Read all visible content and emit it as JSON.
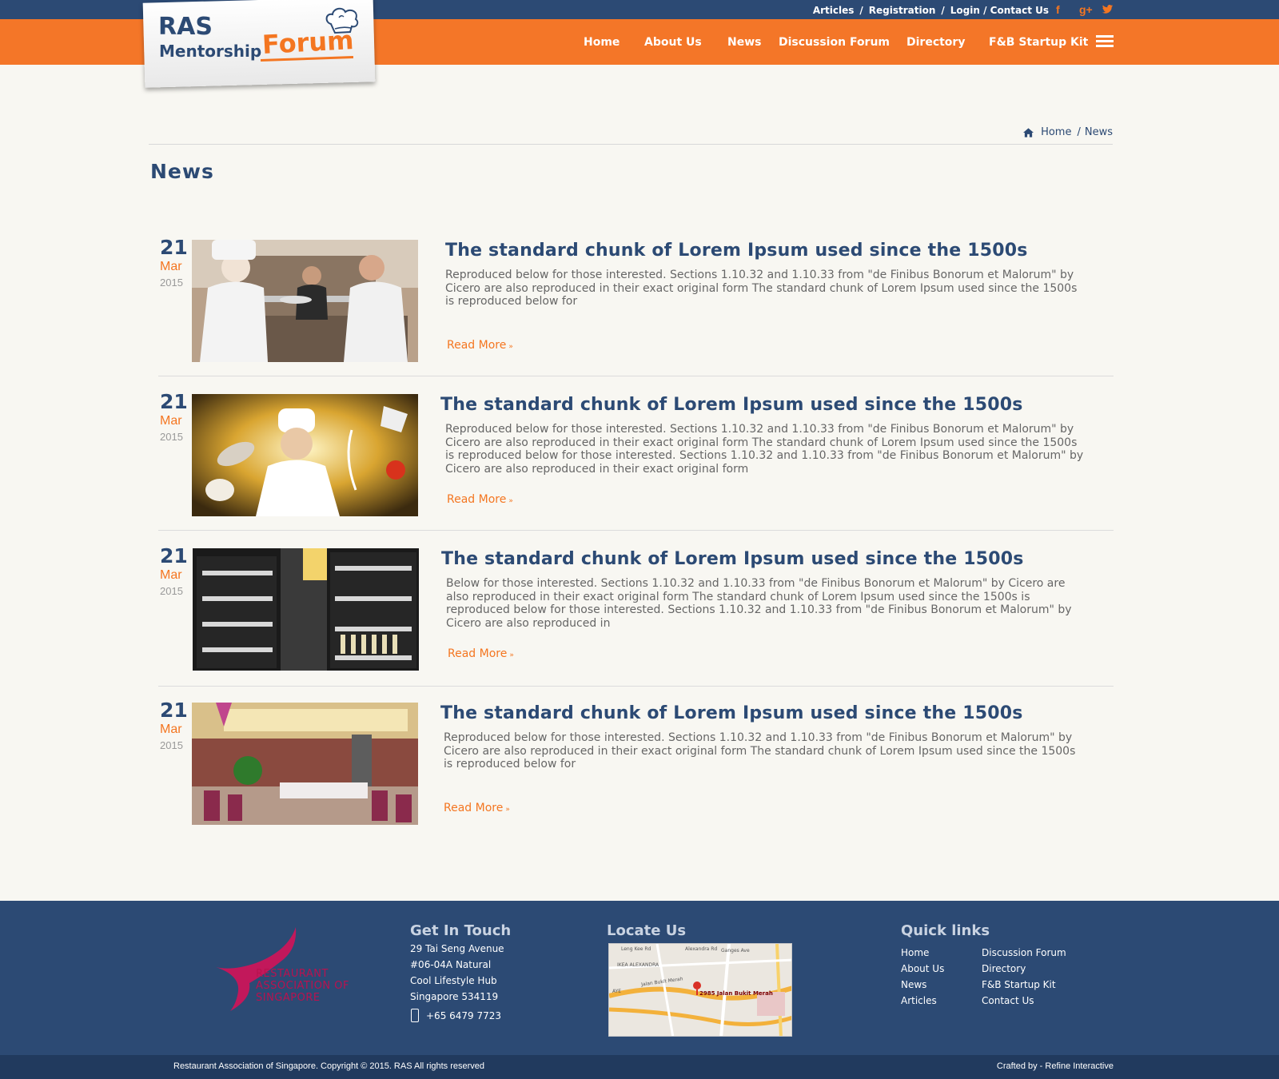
{
  "header": {
    "top_links": {
      "articles": "Articles",
      "sep": "/",
      "registration": "Registration",
      "login_contact": "Login / Contact Us"
    },
    "social": {
      "facebook": "f",
      "google_plus": "g+",
      "twitter": "t"
    },
    "logo": {
      "ras": "RAS",
      "mentorship": "Mentorship",
      "forum": "Forum"
    },
    "nav": {
      "home": "Home",
      "about": "About Us",
      "news": "News",
      "forum": "Discussion Forum",
      "directory": "Directory",
      "startup": "F&B Startup Kit"
    }
  },
  "breadcrumb": {
    "home": "Home",
    "sep": "/",
    "current": "News"
  },
  "page": {
    "title": "News"
  },
  "news": [
    {
      "day": "21",
      "month": "Mar",
      "year": "2015",
      "title": "The standard chunk of Lorem Ipsum used since the 1500s",
      "body": "Reproduced below for those interested. Sections 1.10.32 and 1.10.33 from \"de Finibus Bonorum et Malorum\" by Cicero are also reproduced in their exact original form The standard chunk of Lorem Ipsum used since the 1500s is reproduced below for",
      "read_more": "Read More",
      "arrow": "»"
    },
    {
      "day": "21",
      "month": "Mar",
      "year": "2015",
      "title": "The standard chunk of Lorem Ipsum used since the 1500s",
      "body": "Reproduced below for those interested. Sections 1.10.32 and 1.10.33 from \"de Finibus Bonorum et Malorum\" by Cicero are also reproduced in their exact original form The standard chunk of Lorem Ipsum used since the 1500s is reproduced below for those interested. Sections 1.10.32 and 1.10.33 from \"de Finibus Bonorum et Malorum\" by Cicero are also reproduced in their exact original form",
      "read_more": "Read More",
      "arrow": "»"
    },
    {
      "day": "21",
      "month": "Mar",
      "year": "2015",
      "title": "The standard chunk of Lorem Ipsum used since the 1500s",
      "body": "Below for those interested. Sections 1.10.32 and 1.10.33 from \"de Finibus Bonorum et Malorum\" by Cicero are also reproduced in their exact original form The standard chunk of Lorem Ipsum used since the 1500s is reproduced below for those interested. Sections 1.10.32 and 1.10.33 from \"de Finibus Bonorum et Malorum\" by Cicero are also reproduced in",
      "read_more": "Read More",
      "arrow": "»"
    },
    {
      "day": "21",
      "month": "Mar",
      "year": "2015",
      "title": "The standard chunk of Lorem Ipsum used since the 1500s",
      "body": "Reproduced below for those interested. Sections 1.10.32 and 1.10.33 from \"de Finibus Bonorum et Malorum\" by Cicero are also reproduced in their exact original form The standard chunk of Lorem Ipsum used since the 1500s is reproduced below for",
      "read_more": "Read More",
      "arrow": "»"
    }
  ],
  "footer": {
    "ras_logo": {
      "line1": "RESTAURANT",
      "line2": "ASSOCIATION OF",
      "line3": "SINGAPORE"
    },
    "get_in_touch": {
      "heading": "Get In Touch",
      "address": [
        "29 Tai Seng Avenue",
        "#06-04A Natural",
        "Cool Lifestyle Hub",
        "Singapore 534119"
      ],
      "phone": "+65 6479 7723"
    },
    "locate": {
      "heading": "Locate Us",
      "map_labels": {
        "pin": "2985 Jalan Bukit Merah",
        "road1": "Jalan Bukit Merah",
        "road2": "Alexandra Rd",
        "road3": "IKEA ALEXANDRA",
        "road4": "AYE",
        "road5": "Ganges Ave",
        "road6": "Leng Kee Rd"
      }
    },
    "quick_links": {
      "heading": "Quick links",
      "col1": [
        "Home",
        "About Us",
        "News",
        "Articles"
      ],
      "col2": [
        "Discussion Forum",
        "Directory",
        "F&B Startup Kit",
        "Contact Us"
      ]
    },
    "copyright": "Restaurant Association of Singapore. Copyright © 2015. RAS All rights reserved",
    "crafted": "Crafted by - Refine Interactive"
  },
  "colors": {
    "navy": "#2c4a74",
    "orange": "#f47628",
    "footer_dark": "#213a5e",
    "bg": "#f8f7f2"
  },
  "icons": [
    "home-icon",
    "facebook-icon",
    "google-plus-icon",
    "twitter-icon",
    "menu-icon",
    "phone-icon",
    "map-pin-icon",
    "chef-hat-icon"
  ]
}
